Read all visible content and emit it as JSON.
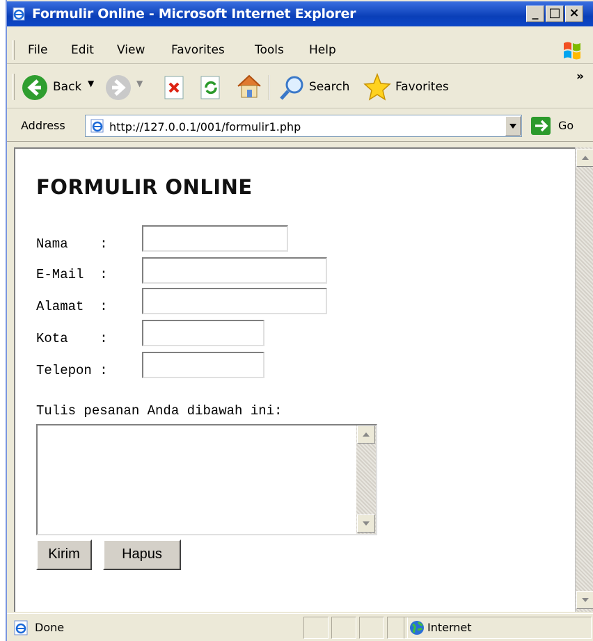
{
  "window": {
    "title": "Formulir Online - Microsoft Internet Explorer",
    "minimize": "_",
    "restore": "□",
    "close": "×"
  },
  "menu": [
    "File",
    "Edit",
    "View",
    "Favorites",
    "Tools",
    "Help"
  ],
  "toolbar": {
    "back_label": "Back",
    "search_label": "Search",
    "favorites_label": "Favorites",
    "overflow": "»"
  },
  "address": {
    "label": "Address",
    "url": "http://127.0.0.1/001/formulir1.php",
    "go_label": "Go"
  },
  "page": {
    "heading": "FORMULIR ONLINE",
    "fields": [
      {
        "label": "Nama    :",
        "value": ""
      },
      {
        "label": "E-Mail  :",
        "value": ""
      },
      {
        "label": "Alamat  :",
        "value": ""
      },
      {
        "label": "Kota    :",
        "value": ""
      },
      {
        "label": "Telepon :",
        "value": ""
      }
    ],
    "message_prompt": "Tulis pesanan Anda dibawah ini:",
    "submit_label": "Kirim",
    "reset_label": "Hapus"
  },
  "status": {
    "text": "Done",
    "zone": "Internet"
  },
  "colors": {
    "titlebar": "#0a3fb8",
    "chrome": "#ece9d8",
    "content_bg": "#ffffff"
  }
}
